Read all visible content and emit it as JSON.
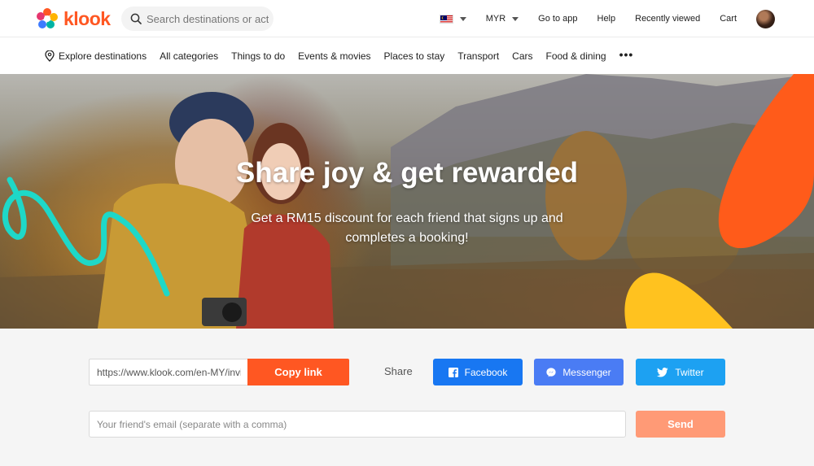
{
  "header": {
    "brand": "klook",
    "search": {
      "placeholder": "Search destinations or activities"
    },
    "locale_flag": "malaysia-flag-icon",
    "currency": "MYR",
    "go_to_app": "Go to app",
    "help": "Help",
    "recently_viewed": "Recently viewed",
    "cart": "Cart"
  },
  "categories": {
    "explore": "Explore destinations",
    "all": "All categories",
    "things": "Things to do",
    "events": "Events & movies",
    "stay": "Places to stay",
    "transport": "Transport",
    "cars": "Cars",
    "food": "Food & dining",
    "more": "•••"
  },
  "hero": {
    "title": "Share joy & get rewarded",
    "subtitle": "Get a RM15 discount for each friend that signs up and completes a booking!"
  },
  "share": {
    "link_value": "https://www.klook.com/en-MY/invite",
    "copy_label": "Copy link",
    "share_label": "Share",
    "facebook": "Facebook",
    "messenger": "Messenger",
    "twitter": "Twitter",
    "email_placeholder": "Your friend's email (separate with a comma)",
    "send_label": "Send"
  },
  "colors": {
    "brand": "#ff5722",
    "facebook": "#1877f2",
    "messenger": "#4a7cf4",
    "twitter": "#1da1f2",
    "send_disabled": "#ff9a76"
  }
}
